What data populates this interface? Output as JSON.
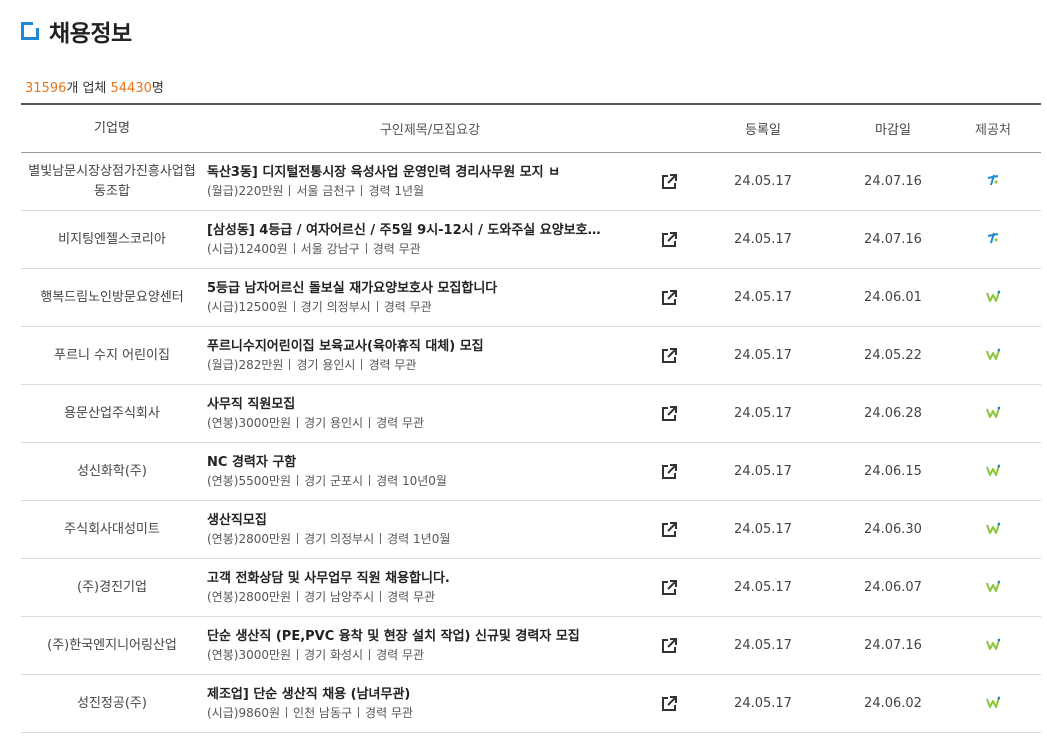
{
  "page": {
    "title": "채용정보"
  },
  "summary": {
    "company_count": "31596",
    "company_unit": "개 업체",
    "job_count": "54430",
    "job_unit": "명"
  },
  "table": {
    "headers": {
      "company": "기업명",
      "title": "구인제목/모집요강",
      "reg": "등록일",
      "close": "마감일",
      "source": "제공처"
    },
    "rows": [
      {
        "company": "별빛남문시장상점가진흥사업협동조합",
        "title": "독산3동] 디지털전통시장 육성사업 운영인력 경리사무원 모지 ㅂ",
        "pay": "(월급)220만원",
        "location": "서울 금천구",
        "career": "경력 1년월",
        "reg": "24.05.17",
        "close": "24.07.16",
        "source_icon": "worknet-icon"
      },
      {
        "company": "비지팅엔젤스코리아",
        "title": "[삼성동] 4등급 / 여자어르신 / 주5일 9시-12시 / 도와주실 요양보호…",
        "pay": "(시급)12400원",
        "location": "서울 강남구",
        "career": "경력 무관",
        "reg": "24.05.17",
        "close": "24.07.16",
        "source_icon": "worknet-icon"
      },
      {
        "company": "행복드림노인방문요양센터",
        "title": "5등급 남자어르신 돌보실 재가요양보호사 모집합니다",
        "pay": "(시급)12500원",
        "location": "경기 의정부시",
        "career": "경력 무관",
        "reg": "24.05.17",
        "close": "24.06.01",
        "source_icon": "w-icon"
      },
      {
        "company": "푸르니 수지 어린이집",
        "title": "푸르니수지어린이집 보육교사(육아휴직 대체) 모집",
        "pay": "(월급)282만원",
        "location": "경기 용인시",
        "career": "경력 무관",
        "reg": "24.05.17",
        "close": "24.05.22",
        "source_icon": "w-icon"
      },
      {
        "company": "용문산업주식회사",
        "title": "사무직 직원모집",
        "pay": "(연봉)3000만원",
        "location": "경기 용인시",
        "career": "경력 무관",
        "reg": "24.05.17",
        "close": "24.06.28",
        "source_icon": "w-icon"
      },
      {
        "company": "성신화학(주)",
        "title": "NC 경력자 구함",
        "pay": "(연봉)5500만원",
        "location": "경기 군포시",
        "career": "경력 10년0월",
        "reg": "24.05.17",
        "close": "24.06.15",
        "source_icon": "w-icon"
      },
      {
        "company": "주식회사대성미트",
        "title": "생산직모집",
        "pay": "(연봉)2800만원",
        "location": "경기 의정부시",
        "career": "경력 1년0월",
        "reg": "24.05.17",
        "close": "24.06.30",
        "source_icon": "w-icon"
      },
      {
        "company": "(주)경진기업",
        "title": "고객 전화상담 및 사무업무 직원 채용합니다.",
        "pay": "(연봉)2800만원",
        "location": "경기 남양주시",
        "career": "경력 무관",
        "reg": "24.05.17",
        "close": "24.06.07",
        "source_icon": "w-icon"
      },
      {
        "company": "(주)한국엔지니어링산업",
        "title": "단순 생산직 (PE,PVC 융착 및 현장 설치 작업) 신규및 경력자 모집",
        "pay": "(연봉)3000만원",
        "location": "경기 화성시",
        "career": "경력 무관",
        "reg": "24.05.17",
        "close": "24.07.16",
        "source_icon": "w-icon"
      },
      {
        "company": "성진정공(주)",
        "title": "제조업] 단순 생산직 채용 (남녀무관)",
        "pay": "(시급)9860원",
        "location": "인천 남동구",
        "career": "경력 무관",
        "reg": "24.05.17",
        "close": "24.06.02",
        "source_icon": "w-icon"
      }
    ]
  },
  "colors": {
    "accent": "#1e88d0",
    "count": "#e8751a",
    "w_green": "#8cc63f",
    "w_blue": "#1e88d0"
  }
}
